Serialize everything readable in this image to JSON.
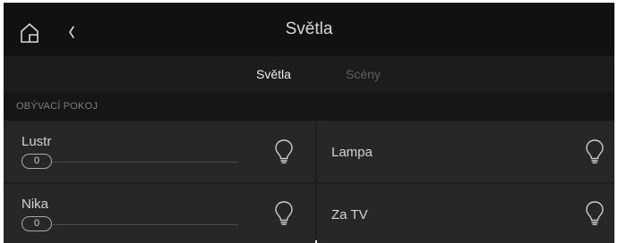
{
  "header": {
    "title": "Světla",
    "home_icon": "home-icon",
    "back_icon": "chevron-left-icon"
  },
  "tabs": [
    {
      "label": "Světla",
      "active": true
    },
    {
      "label": "Scény",
      "active": false
    }
  ],
  "section": {
    "title": "OBÝVACÍ POKOJ"
  },
  "lights": [
    {
      "name": "Lustr",
      "dimmable": true,
      "level": "0",
      "icon": "lightbulb-icon"
    },
    {
      "name": "Lampa",
      "dimmable": false,
      "icon": "lightbulb-icon"
    },
    {
      "name": "Nika",
      "dimmable": true,
      "level": "0",
      "icon": "lightbulb-icon"
    },
    {
      "name": "Za TV",
      "dimmable": false,
      "icon": "lightbulb-icon"
    }
  ],
  "colors": {
    "background": "#1e1e1e",
    "header": "#111111",
    "tile": "#272727",
    "text": "#d4d4d4",
    "inactive_tab": "#5e5e5e"
  }
}
